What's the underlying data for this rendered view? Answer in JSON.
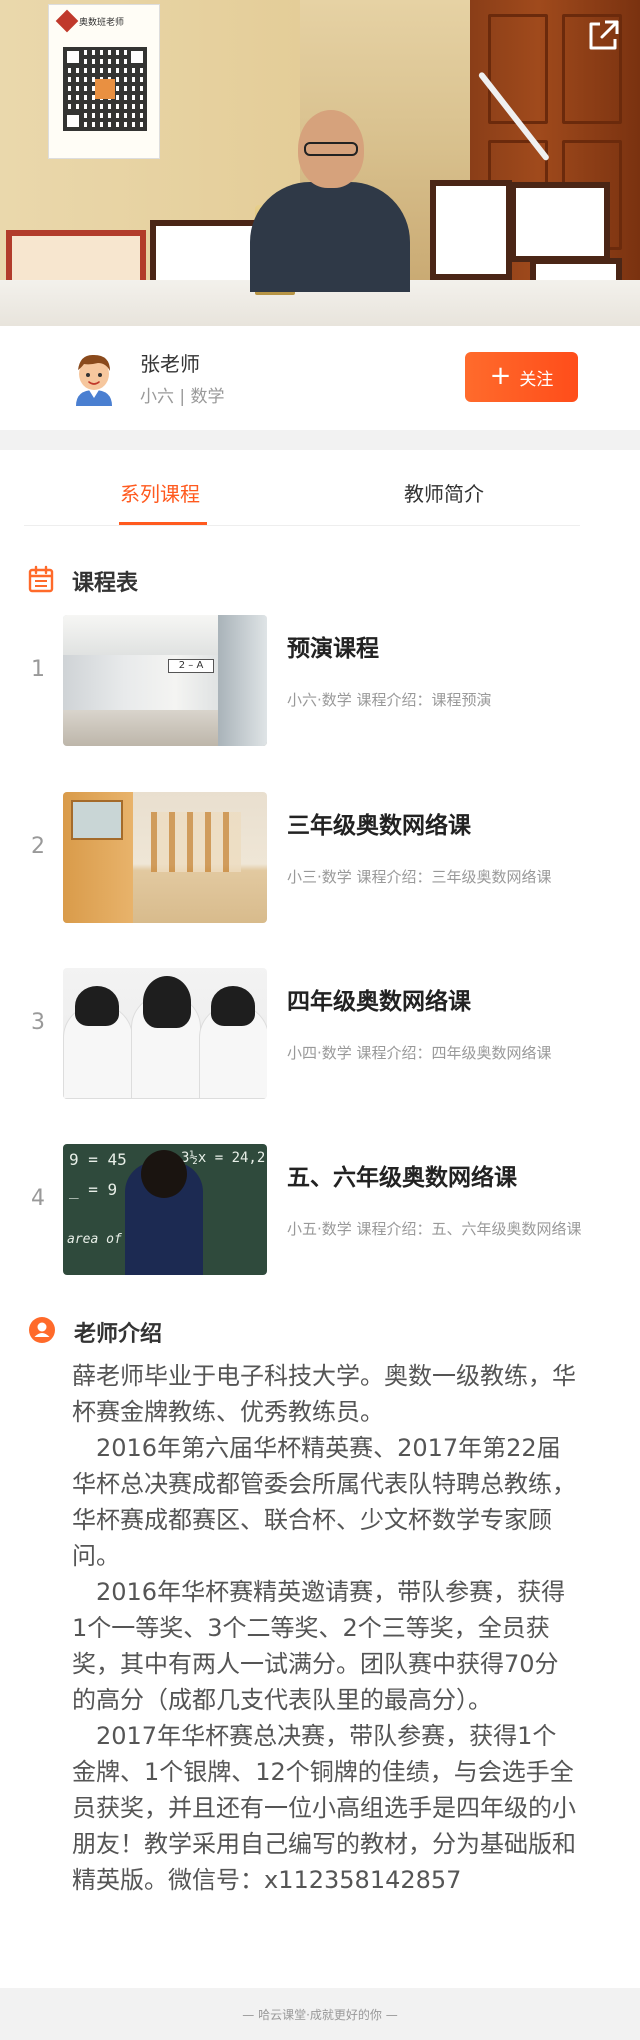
{
  "hero": {
    "qr_card_title": "奥数班老师"
  },
  "teacher": {
    "name": "张老师",
    "subtitle": "小六 | 数学",
    "follow_label": "关注"
  },
  "tabs": [
    {
      "label": "系列课程",
      "active": true
    },
    {
      "label": "教师简介",
      "active": false
    }
  ],
  "schedule": {
    "title": "课程表",
    "courses": [
      {
        "index": "1",
        "title": "预演课程",
        "meta": "小六·数学   课程介绍：课程预演",
        "thumb": "school-corridor-sign-2A"
      },
      {
        "index": "2",
        "title": "三年级奥数网络课",
        "meta": "小三·数学   课程介绍：三年级奥数网络课",
        "thumb": "school-hallway-lockers"
      },
      {
        "index": "3",
        "title": "四年级奥数网络课",
        "meta": "小四·数学   课程介绍：四年级奥数网络课",
        "thumb": "students-back-view"
      },
      {
        "index": "4",
        "title": "五、六年级奥数网络课",
        "meta": "小五·数学   课程介绍：五、六年级奥数网络课",
        "thumb": "boy-at-chalkboard"
      }
    ]
  },
  "intro": {
    "title": "老师介绍",
    "paragraphs": [
      "薛老师毕业于电子科技大学。奥数一级教练，华杯赛金牌教练、优秀教练员。",
      "2016年第六届华杯精英赛、2017年第22届华杯总决赛成都管委会所属代表队特聘总教练，华杯赛成都赛区、联合杯、少文杯数学专家顾问。",
      "2016年华杯赛精英邀请赛，带队参赛，获得1个一等奖、3个二等奖、2个三等奖，全员获奖，其中有两人一试满分。团队赛中获得70分的高分（成都几支代表队里的最高分）。",
      "2017年华杯赛总决赛，带队参赛，获得1个金牌、1个银牌、12个铜牌的佳绩，与会选手全员获奖，并且还有一位小高组选手是四年级的小朋友！教学采用自己编写的教材，分为基础版和精英版。微信号：x112358142857"
    ]
  },
  "chalkboard": {
    "line1": "9 = 45",
    "line2": "_ = 9",
    "line3": "3½x = 24,2",
    "line4": "area of"
  },
  "footer": {
    "text": "— 哈云课堂·成就更好的你 —"
  },
  "colors": {
    "accent": "#ff5a1f",
    "follow_gradient_start": "#ff6b2c",
    "follow_gradient_end": "#ff4d1a",
    "divider": "#f2f2f2"
  },
  "icons": {
    "share": "share-external-icon",
    "schedule": "calendar-icon",
    "intro": "person-icon",
    "follow": "plus-icon"
  }
}
